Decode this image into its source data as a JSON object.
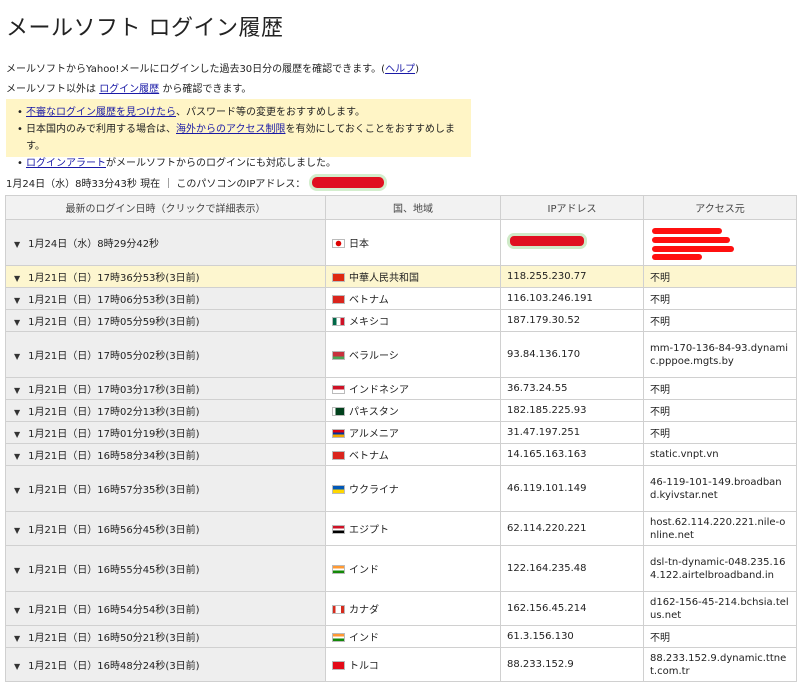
{
  "page": {
    "title": "メールソフト ログイン履歴",
    "intro_text": "メールソフトからYahoo!メールにログインした過去30日分の履歴を確認できます。(",
    "help_link": "ヘルプ",
    "intro_close": ")",
    "line2_prefix": "メールソフト以外は ",
    "line2_link": "ログイン履歴",
    "line2_suffix": " から確認できます。"
  },
  "notice": {
    "item1_link": "不審なログイン履歴を見つけたら",
    "item1_text": "、パスワード等の変更をおすすめします。",
    "item2_prefix": "日本国内のみで利用する場合は、",
    "item2_link": "海外からのアクセス制限",
    "item2_suffix": "を有効にしておくことをおすすめします。",
    "item3_link": "ログインアラート",
    "item3_text": "がメールソフトからのログインにも対応しました。"
  },
  "status": {
    "text": "1月24日（水）8時33分43秒 現在 ｜ このパソコンのIPアドレス："
  },
  "table": {
    "headers": {
      "date": "最新のログイン日時（クリックで詳細表示）",
      "country": "国、地域",
      "ip": "IPアドレス",
      "host": "アクセス元"
    },
    "rows": [
      {
        "date": "1月24日（水）8時29分42秒",
        "country": "日本",
        "ip": "",
        "host": ""
      },
      {
        "date": "1月21日（日）17時36分53秒(3日前)",
        "country": "中華人民共和国",
        "ip": "118.255.230.77",
        "host": "不明"
      },
      {
        "date": "1月21日（日）17時06分53秒(3日前)",
        "country": "ベトナム",
        "ip": "116.103.246.191",
        "host": "不明"
      },
      {
        "date": "1月21日（日）17時05分59秒(3日前)",
        "country": "メキシコ",
        "ip": "187.179.30.52",
        "host": "不明"
      },
      {
        "date": "1月21日（日）17時05分02秒(3日前)",
        "country": "ベラルーシ",
        "ip": "93.84.136.170",
        "host": "mm-170-136-84-93.dynamic.pppoe.mgts.by"
      },
      {
        "date": "1月21日（日）17時03分17秒(3日前)",
        "country": "インドネシア",
        "ip": "36.73.24.55",
        "host": "不明"
      },
      {
        "date": "1月21日（日）17時02分13秒(3日前)",
        "country": "パキスタン",
        "ip": "182.185.225.93",
        "host": "不明"
      },
      {
        "date": "1月21日（日）17時01分19秒(3日前)",
        "country": "アルメニア",
        "ip": "31.47.197.251",
        "host": "不明"
      },
      {
        "date": "1月21日（日）16時58分34秒(3日前)",
        "country": "ベトナム",
        "ip": "14.165.163.163",
        "host": "static.vnpt.vn"
      },
      {
        "date": "1月21日（日）16時57分35秒(3日前)",
        "country": "ウクライナ",
        "ip": "46.119.101.149",
        "host": "46-119-101-149.broadband.kyivstar.net"
      },
      {
        "date": "1月21日（日）16時56分45秒(3日前)",
        "country": "エジプト",
        "ip": "62.114.220.221",
        "host": "host.62.114.220.221.nile-online.net"
      },
      {
        "date": "1月21日（日）16時55分45秒(3日前)",
        "country": "インド",
        "ip": "122.164.235.48",
        "host": "dsl-tn-dynamic-048.235.164.122.airtelbroadband.in"
      },
      {
        "date": "1月21日（日）16時54分54秒(3日前)",
        "country": "カナダ",
        "ip": "162.156.45.214",
        "host": "d162-156-45-214.bchsia.telus.net"
      },
      {
        "date": "1月21日（日）16時50分21秒(3日前)",
        "country": "インド",
        "ip": "61.3.156.130",
        "host": "不明"
      },
      {
        "date": "1月21日（日）16時48分24秒(3日前)",
        "country": "トルコ",
        "ip": "88.233.152.9",
        "host": "88.233.152.9.dynamic.ttnet.com.tr"
      }
    ]
  },
  "icons": {
    "expand": "triangle-down-icon"
  },
  "colors": {
    "highlight_row": "#fdf6cf",
    "notice_bg": "#fff5c6",
    "link": "#1a1aa6",
    "redaction": "#e01020"
  }
}
